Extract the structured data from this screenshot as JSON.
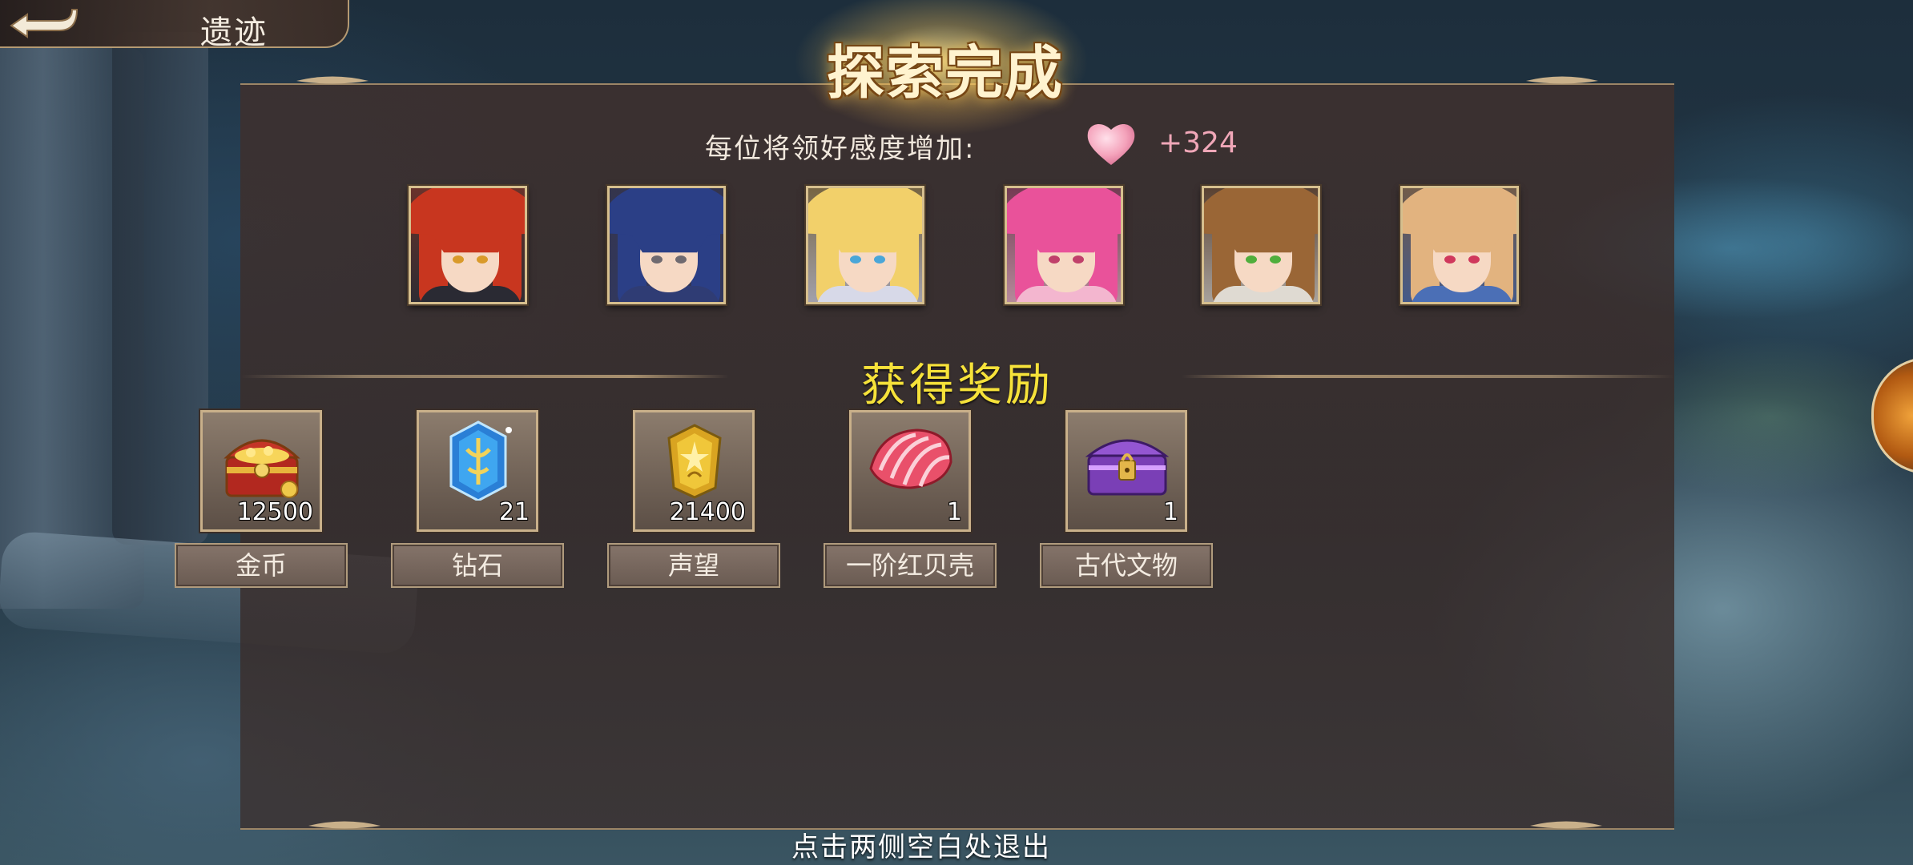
{
  "header": {
    "back_label": "遗迹"
  },
  "result": {
    "title": "探索完成",
    "affinity_label": "每位将领好感度增加:",
    "affinity_value": "+324",
    "heroes": [
      {
        "name": "red-haired-hero",
        "hair": "#c8361f",
        "eyes": "#d99a2a",
        "body": "#2a2a33"
      },
      {
        "name": "blue-haired-hero",
        "hair": "#2b3f86",
        "eyes": "#6f6a70",
        "body": "#2f3c74"
      },
      {
        "name": "blonde-princess-hero",
        "hair": "#f2d06a",
        "eyes": "#4aa6d8",
        "body": "#d7d9e8"
      },
      {
        "name": "pink-haired-hero",
        "hair": "#e9529a",
        "eyes": "#c0406a",
        "body": "#f3b6cf"
      },
      {
        "name": "brown-haired-hero",
        "hair": "#9a6636",
        "eyes": "#4fae3c",
        "body": "#dfdad2"
      },
      {
        "name": "light-brown-haired-hero",
        "hair": "#e2b37f",
        "eyes": "#d0385c",
        "body": "#4b6fb6"
      }
    ],
    "rewards_title": "获得奖励",
    "rewards": [
      {
        "name": "金币",
        "qty": "12500",
        "icon": "treasure-chest-icon"
      },
      {
        "name": "钻石",
        "qty": "21",
        "icon": "blue-crystal-icon"
      },
      {
        "name": "声望",
        "qty": "21400",
        "icon": "gold-badge-icon"
      },
      {
        "name": "一阶红贝壳",
        "qty": "1",
        "icon": "red-shell-icon"
      },
      {
        "name": "古代文物",
        "qty": "1",
        "icon": "purple-chest-icon"
      }
    ],
    "exit_hint": "点击两侧空白处退出"
  },
  "colors": {
    "title_glow": "#ffe696",
    "rewards_title": "#f6e23a",
    "affinity_value": "#f0a7b8",
    "frame_gold": "#c9b08a"
  }
}
